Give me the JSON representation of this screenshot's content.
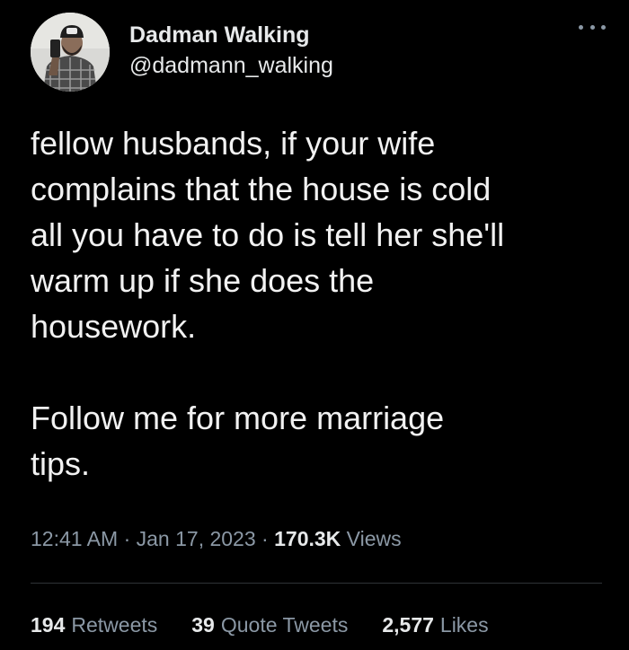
{
  "user": {
    "display_name": "Dadman Walking",
    "handle": "@dadmann_walking"
  },
  "tweet": {
    "text": "fellow husbands, if your wife\ncomplains that the house is cold\nall you have to do is tell her she'll\nwarm up if she does the\nhousework.\n\nFollow me for more marriage\ntips."
  },
  "meta": {
    "time": "12:41 AM",
    "separator": "·",
    "date": "Jan 17, 2023",
    "views_count": "170.3K",
    "views_label": "Views"
  },
  "stats": {
    "retweets_count": "194",
    "retweets_label": "Retweets",
    "quotes_count": "39",
    "quotes_label": "Quote Tweets",
    "likes_count": "2,577",
    "likes_label": "Likes"
  },
  "colors": {
    "background": "#000000",
    "text_primary": "#e7e9ea",
    "text_secondary": "#8b98a5",
    "divider": "#2f3336"
  },
  "icons": {
    "more": "more-horizontal-icon"
  }
}
